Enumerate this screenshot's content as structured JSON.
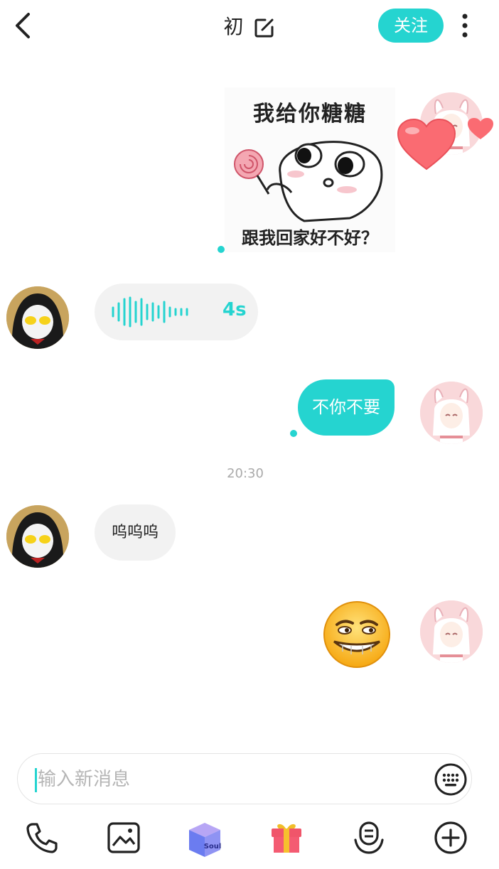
{
  "header": {
    "title": "初",
    "follow_label": "关注",
    "icons": [
      "back-arrow-icon",
      "edit-icon",
      "more-vertical-icon"
    ]
  },
  "messages": {
    "sticker": {
      "top_text": "我给你糖糖",
      "bottom_text": "跟我回家好不好？"
    },
    "voice": {
      "duration": "4s"
    },
    "outgoing_text": "不你不要",
    "timestamp": "20:30",
    "incoming_text": "呜呜呜",
    "emoji": "grinning-face-emoji"
  },
  "composer": {
    "placeholder": "输入新消息",
    "value": ""
  },
  "toolbar": {
    "icons": [
      "phone-icon",
      "image-icon",
      "soul-box-icon",
      "gift-icon",
      "voice-avatar-icon",
      "plus-circle-icon"
    ],
    "soul_box_label": "Soul"
  },
  "colors": {
    "accent": "#25d4d0",
    "bubble_gray": "#f2f2f2",
    "heart": "#fa6b72"
  }
}
